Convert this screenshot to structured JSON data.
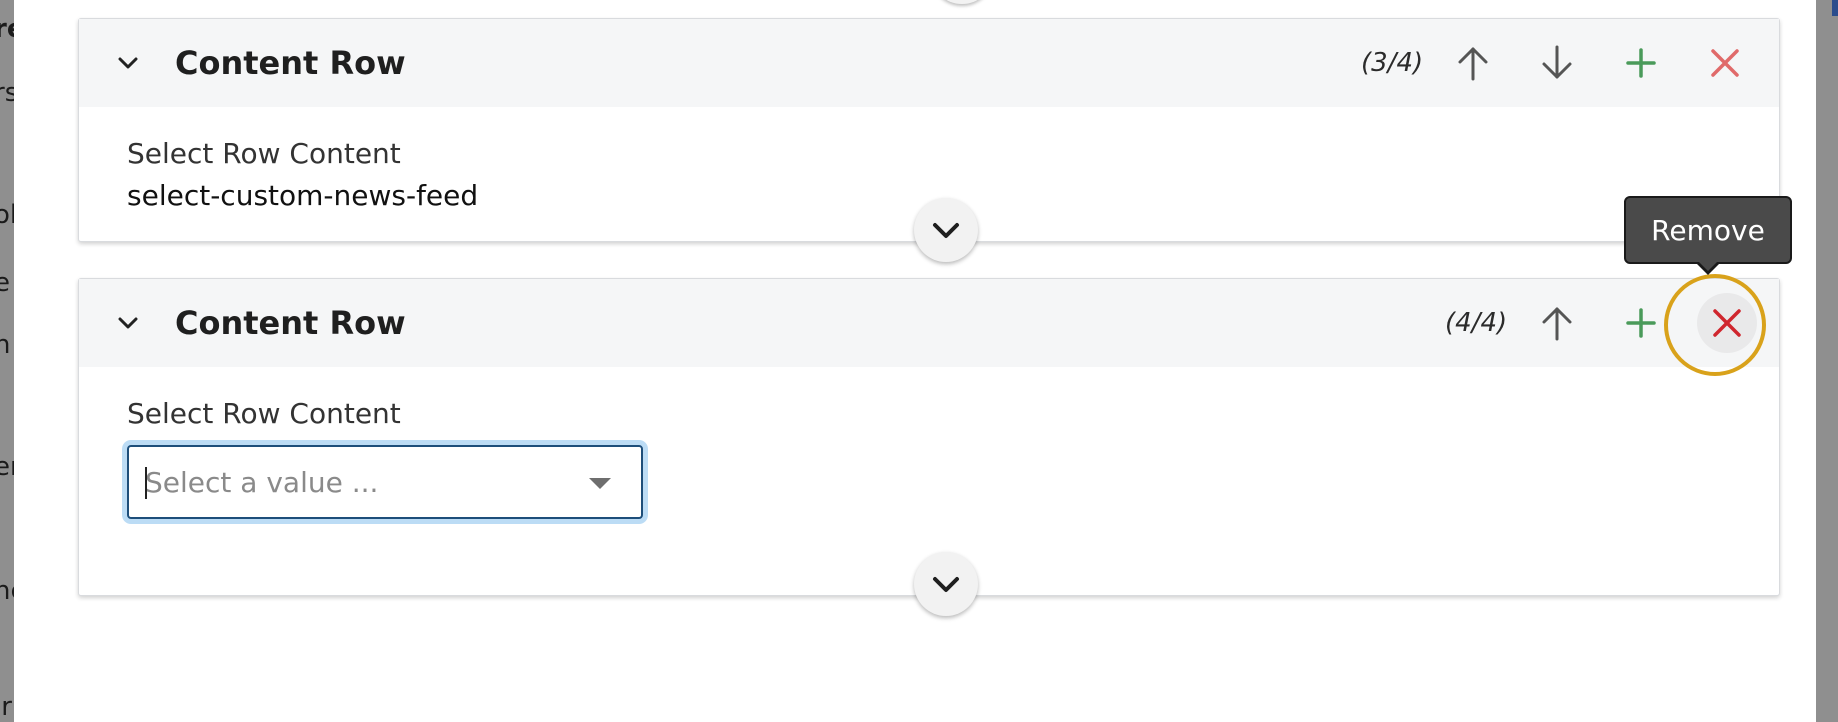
{
  "backdrop": {
    "left_fragments": [
      "re",
      "rs",
      "ol",
      "e",
      "n",
      "er",
      "nc",
      "ir"
    ]
  },
  "rows": [
    {
      "title": "Content Row",
      "counter": "(3/4)",
      "field_label": "Select Row Content",
      "field_value": "select-custom-news-feed",
      "actions": [
        "move-up-icon",
        "move-down-icon",
        "add-icon",
        "remove-icon"
      ]
    },
    {
      "title": "Content Row",
      "counter": "(4/4)",
      "field_label": "Select Row Content",
      "select_placeholder": "Select a value ...",
      "actions": [
        "move-up-icon",
        "add-icon",
        "remove-icon"
      ]
    }
  ],
  "tooltip": {
    "text": "Remove"
  },
  "colors": {
    "add": "#4a9a5a",
    "remove_soft": "#e06a6a",
    "remove_active": "#d0262e",
    "arrow": "#555555",
    "focus_ring": "#d9a21b",
    "select_border": "#1d4e7a",
    "select_glow": "#bcdcf5"
  }
}
